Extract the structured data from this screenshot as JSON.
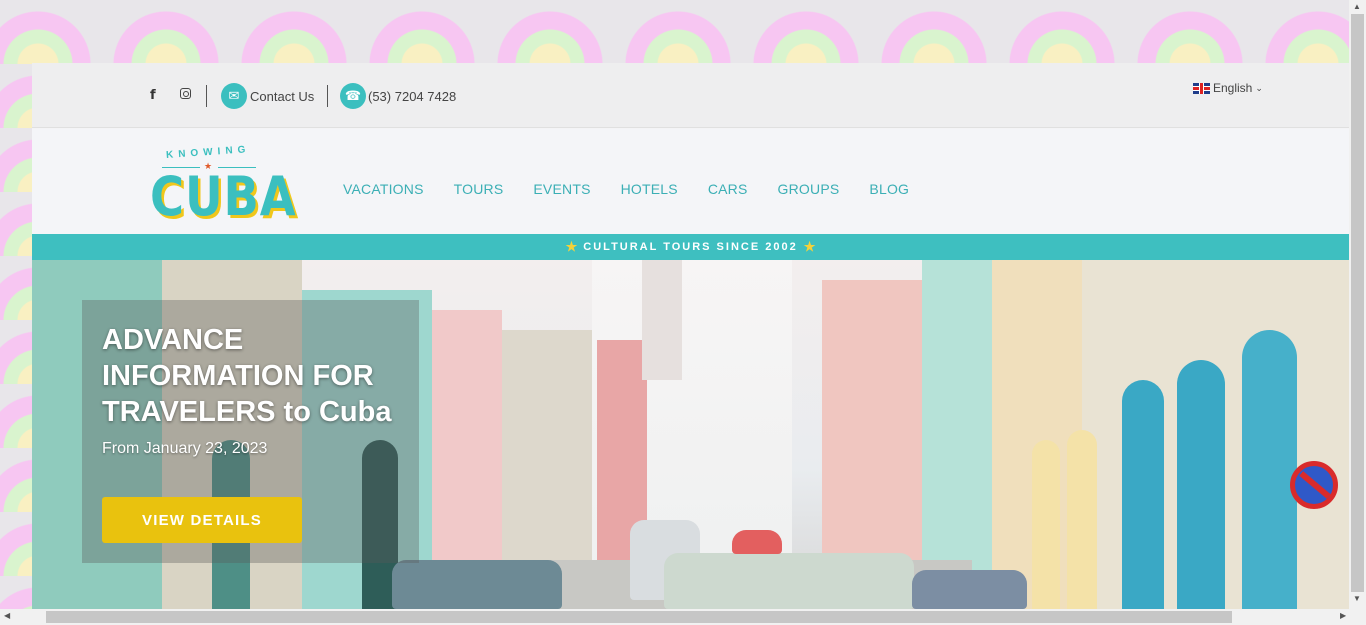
{
  "topbar": {
    "facebook_icon": "facebook-icon",
    "instagram_icon": "instagram-icon",
    "contact_label": "Contact Us",
    "phone": "(53) 7204 7428",
    "language": "English"
  },
  "logo": {
    "top_text": "KNOWING",
    "main_text": "CUBA"
  },
  "nav": {
    "items": [
      "VACATIONS",
      "TOURS",
      "EVENTS",
      "HOTELS",
      "CARS",
      "GROUPS",
      "BLOG"
    ]
  },
  "strip": {
    "text": "CULTURAL TOURS SINCE 2002"
  },
  "hero": {
    "title": "ADVANCE INFORMATION FOR TRAVELERS to Cuba",
    "date": "From January 23, 2023",
    "button": "VIEW DETAILS"
  },
  "colors": {
    "accent": "#3bbfbf",
    "button": "#e9c20e"
  }
}
